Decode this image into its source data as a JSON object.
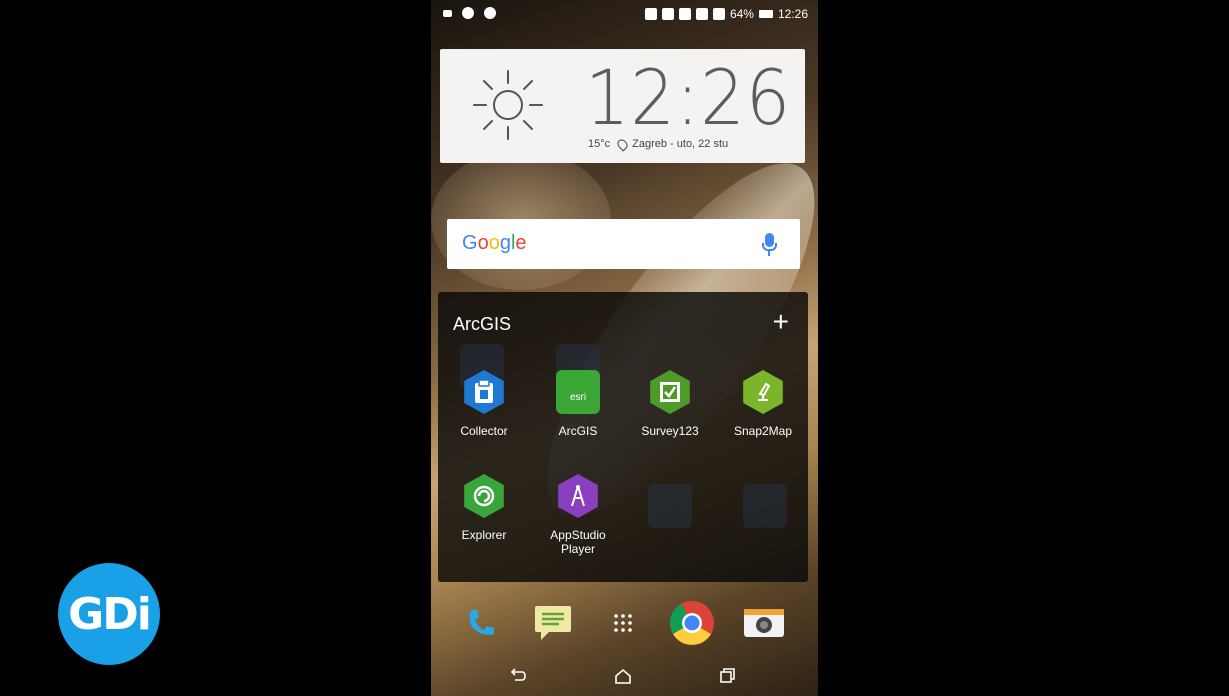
{
  "status_bar": {
    "battery": "64%",
    "time": "12:26"
  },
  "clock_widget": {
    "time": "12:26",
    "temperature": "15°c",
    "location_date": "Zagreb - uto, 22 stu"
  },
  "search": {
    "logo": "Google"
  },
  "folder": {
    "title": "ArcGIS",
    "add": "+",
    "apps": [
      {
        "label": "Collector",
        "icon": "collector-icon",
        "color": "#1f78d1"
      },
      {
        "label": "ArcGIS",
        "icon": "arcgis-icon",
        "color": "#3aa635"
      },
      {
        "label": "Survey123",
        "icon": "survey123-icon",
        "color": "#4f9b2a"
      },
      {
        "label": "Snap2Map",
        "icon": "snap2map-icon",
        "color": "#7ab52a"
      },
      {
        "label": "Explorer",
        "icon": "explorer-icon",
        "color": "#38a63b"
      },
      {
        "label": "AppStudio Player",
        "label_line1": "AppStudio",
        "label_line2": "Player",
        "icon": "appstudio-icon",
        "color": "#8a3fbf"
      }
    ]
  },
  "dock": [
    {
      "name": "phone-icon"
    },
    {
      "name": "messages-icon"
    },
    {
      "name": "app-drawer-icon"
    },
    {
      "name": "chrome-icon"
    },
    {
      "name": "camera-icon"
    }
  ],
  "navbar": {
    "back": "back-icon",
    "home": "home-icon",
    "recents": "recents-icon"
  },
  "watermark": {
    "text": "GDi",
    "color": "#1aa0e6"
  }
}
